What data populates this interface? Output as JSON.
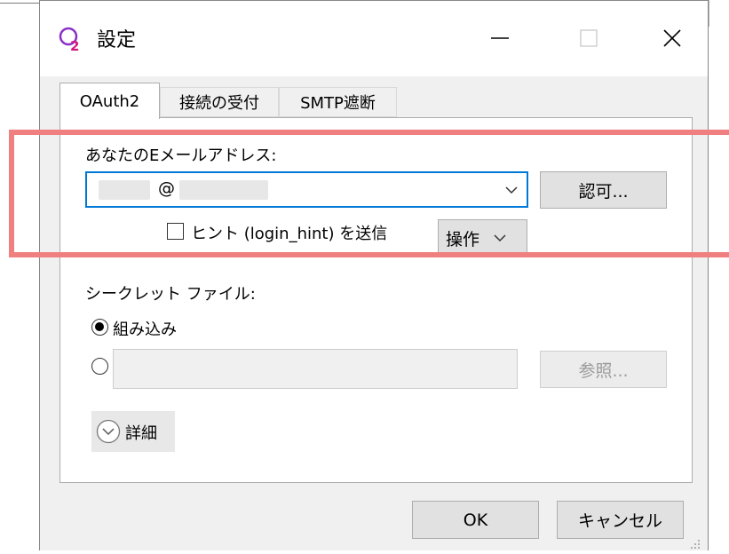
{
  "window": {
    "title": "設定",
    "icon": "app-q2-icon",
    "controls": [
      "minimize-icon",
      "maximize-icon",
      "close-icon"
    ]
  },
  "tabs": [
    {
      "label": "OAuth2",
      "active": true
    },
    {
      "label": "接続の受付",
      "active": false
    },
    {
      "label": "SMTP遮断",
      "active": false
    }
  ],
  "email": {
    "label": "あなたのEメールアドレス:",
    "value_visible": "@",
    "authorize_button": "認可..."
  },
  "hint": {
    "checkbox_label": "ヒント (login_hint) を送信",
    "checked": false,
    "action_button": "操作"
  },
  "secret": {
    "label": "シークレット ファイル:",
    "option_builtin": "組み込み",
    "builtin_selected": true,
    "browse_button": "参照..."
  },
  "details": {
    "label": "詳細"
  },
  "footer": {
    "ok_button": "OK",
    "cancel_button": "キャンセル"
  },
  "colors": {
    "highlight": "#f08080",
    "focus_border": "#0078d7",
    "icon_accent": "#b21fb8"
  }
}
